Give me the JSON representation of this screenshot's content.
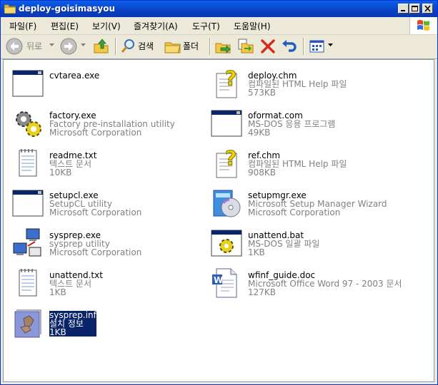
{
  "window": {
    "title": "deploy-goisimasyou"
  },
  "menu": [
    "파일(F)",
    "편집(E)",
    "보기(V)",
    "즐겨찾기(A)",
    "도구(T)",
    "도움말(H)"
  ],
  "toolbar": {
    "back_label": "뒤로",
    "search_label": "검색",
    "folders_label": "폴더"
  },
  "files": [
    {
      "name": "cvtarea.exe",
      "line2": "",
      "line3": "",
      "icon": "exe-window-icon"
    },
    {
      "name": "deploy.chm",
      "line2": "컴파일된 HTML Help 파일",
      "line3": "573KB",
      "icon": "chm-help-icon"
    },
    {
      "name": "factory.exe",
      "line2": "Factory pre-installation utility",
      "line3": "Microsoft Corporation",
      "icon": "gears-icon"
    },
    {
      "name": "oformat.com",
      "line2": "MS-DOS 응용 프로그램",
      "line3": "49KB",
      "icon": "exe-window-icon"
    },
    {
      "name": "readme.txt",
      "line2": "텍스트 문서",
      "line3": "10KB",
      "icon": "notepad-icon"
    },
    {
      "name": "ref.chm",
      "line2": "컴파일된 HTML Help 파일",
      "line3": "908KB",
      "icon": "chm-help-icon"
    },
    {
      "name": "setupcl.exe",
      "line2": "SetupCL utility",
      "line3": "Microsoft Corporation",
      "icon": "exe-window-icon"
    },
    {
      "name": "setupmgr.exe",
      "line2": "Microsoft Setup Manager Wizard",
      "line3": "Microsoft Corporation",
      "icon": "setup-cd-icon"
    },
    {
      "name": "sysprep.exe",
      "line2": "sysprep utility",
      "line3": "Microsoft Corporation",
      "icon": "network-computers-icon"
    },
    {
      "name": "unattend.bat",
      "line2": "MS-DOS 일괄 파일",
      "line3": "1KB",
      "icon": "batch-gear-icon"
    },
    {
      "name": "unattend.txt",
      "line2": "텍스트 문서",
      "line3": "1KB",
      "icon": "notepad-icon"
    },
    {
      "name": "wfinf_guide.doc",
      "line2": "Microsoft Office Word 97 - 2003 문서",
      "line3": "127KB",
      "icon": "word-doc-icon"
    },
    {
      "name": "sysprep.inf",
      "line2": "설치 정보",
      "line3": "1KB",
      "icon": "inf-setup-icon",
      "selected": true
    }
  ]
}
